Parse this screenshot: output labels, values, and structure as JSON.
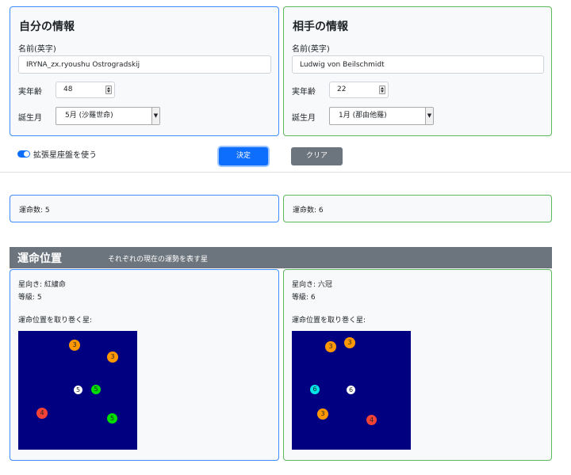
{
  "self": {
    "title": "自分の情報",
    "name_label": "名前(英字)",
    "name_value": "IRYNA_zx.ryoushu Ostrogradskij",
    "age_label": "実年齢",
    "age_value": "48",
    "birth_label": "誕生月",
    "birth_value": "5月 (沙羅世命)"
  },
  "other": {
    "title": "相手の情報",
    "name_label": "名前(英字)",
    "name_value": "Ludwig von Beilschmidt",
    "age_label": "実年齢",
    "age_value": "22",
    "birth_label": "誕生月",
    "birth_value": "1月 (那由他羅)"
  },
  "controls": {
    "toggle_label": "拡張星座盤を使う",
    "toggle_on": true,
    "decide_label": "決定",
    "clear_label": "クリア"
  },
  "results": {
    "self_text": "運命数: 5",
    "other_text": "運命数: 6"
  },
  "section": {
    "title": "運命位置",
    "subtitle": "それぞれの現在の運勢を表す星"
  },
  "position": {
    "self": {
      "direction": "星向き: 紅繍命",
      "level": "等級: 5",
      "surround_label": "運命位置を取り巻く星:",
      "stars": [
        {
          "label": "3",
          "color": "#ff9800"
        },
        {
          "label": "3",
          "color": "#ff9800"
        },
        {
          "label": "5",
          "color": "#ffffff"
        },
        {
          "label": "5",
          "color": "#00e000"
        },
        {
          "label": "4",
          "color": "#f44336"
        },
        {
          "label": "5",
          "color": "#00e000"
        }
      ]
    },
    "other": {
      "direction": "星向き: 六冠",
      "level": "等級: 6",
      "surround_label": "運命位置を取り巻く星:",
      "stars": [
        {
          "label": "3",
          "color": "#ff9800"
        },
        {
          "label": "3",
          "color": "#ff9800"
        },
        {
          "label": "6",
          "color": "#00e5e5"
        },
        {
          "label": "6",
          "color": "#ffffff"
        },
        {
          "label": "3",
          "color": "#ff9800"
        },
        {
          "label": "4",
          "color": "#f44336"
        }
      ]
    }
  },
  "colors": {
    "primary": "#0d6efd",
    "secondary": "#6c757d",
    "self_border": "#3d8bfd",
    "other_border": "#5cb85c",
    "board": "#000080"
  }
}
